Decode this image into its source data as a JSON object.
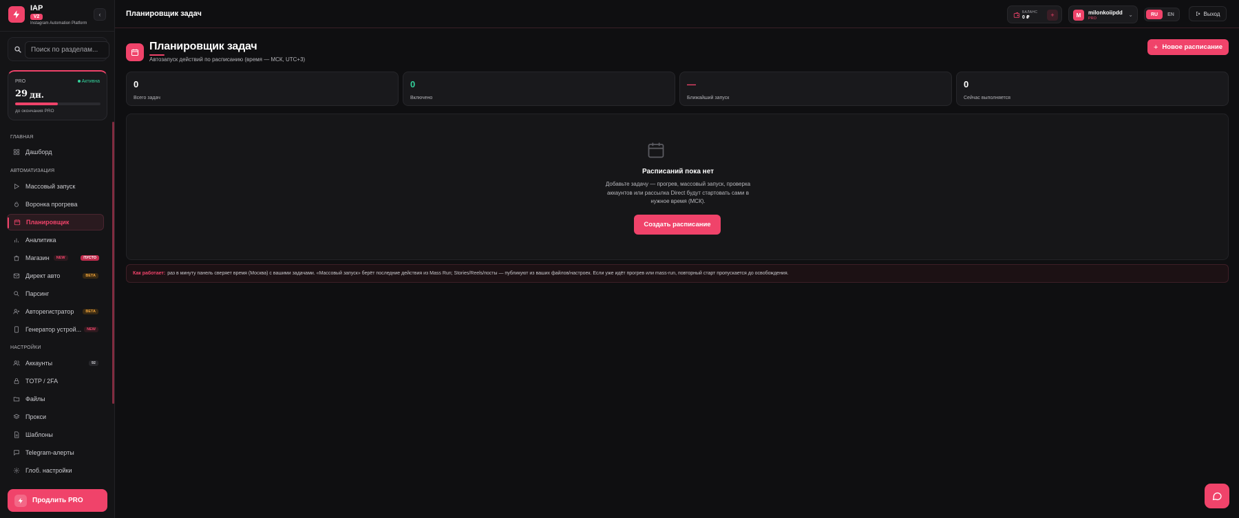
{
  "brand": {
    "name": "IAP",
    "version": "V2",
    "subtitle": "Instagram Automation Platform"
  },
  "sidebar": {
    "search_placeholder": "Поиск по разделам...",
    "pro": {
      "label": "PRO",
      "status": "Активна",
      "days": "29",
      "days_unit": "дн.",
      "caption": "до окончания PRO",
      "progress": 0.5
    },
    "sections": {
      "main": "ГЛАВНАЯ",
      "automation": "АВТОМАТИЗАЦИЯ",
      "settings": "НАСТРОЙКИ"
    },
    "items": {
      "dashboard": "Дашборд",
      "mass_run": "Массовый запуск",
      "funnel": "Воронка прогрева",
      "scheduler": "Планировщик",
      "analytics": "Аналитика",
      "shop": "Магазин",
      "direct": "Директ авто",
      "parsing": "Парсинг",
      "autoreg": "Авторегистратор",
      "device_gen": "Генератор устрой...",
      "accounts": "Аккаунты",
      "totp": "TOTP / 2FA",
      "files": "Файлы",
      "proxies": "Прокси",
      "templates": "Шаблоны",
      "telegram": "Telegram-алерты",
      "global": "Глоб. настройки"
    },
    "badges": {
      "new": "NEW",
      "empty": "ПУСТО",
      "beta": "BETA",
      "accounts_count": "92"
    },
    "renew_label": "Продлить PRO"
  },
  "header": {
    "title": "Планировщик задач",
    "balance_label": "БАЛАНС",
    "balance_value": "0 ₽",
    "balance_add": "+",
    "user_initial": "M",
    "user_name": "milonkoiipdd",
    "user_plan": "PRO",
    "lang_ru": "RU",
    "lang_en": "EN",
    "logout": "Выход"
  },
  "main": {
    "title": "Планировщик задач",
    "subtitle": "Автозапуск действий по расписанию (время — МСК, UTC+3)",
    "new_button": "Новое расписание",
    "stats": [
      {
        "value": "0",
        "label": "Всего задач"
      },
      {
        "value": "0",
        "label": "Включено"
      },
      {
        "value": "—",
        "label": "Ближайший запуск"
      },
      {
        "value": "0",
        "label": "Сейчас выполняется"
      }
    ],
    "empty": {
      "title": "Расписаний пока нет",
      "description": "Добавьте задачу — прогрев, массовый запуск, проверка аккаунтов или рассылка Direct будут стартовать сами в нужное время (МСК).",
      "button": "Создать расписание"
    },
    "info": {
      "strong": "Как работает:",
      "text": "раз в минуту панель сверяет время (Москва) с вашими задачами. «Массовый запуск» берёт последние действия из Mass Run; Stories/Reels/посты — публикуют из ваших файлов/настроек. Если уже идёт прогрев или mass-run, повторный старт пропускается до освобождения."
    }
  },
  "colors": {
    "accent": "#f0436a",
    "success": "#33d19b",
    "warning": "#f0a43c",
    "background": "#0f0f11"
  }
}
